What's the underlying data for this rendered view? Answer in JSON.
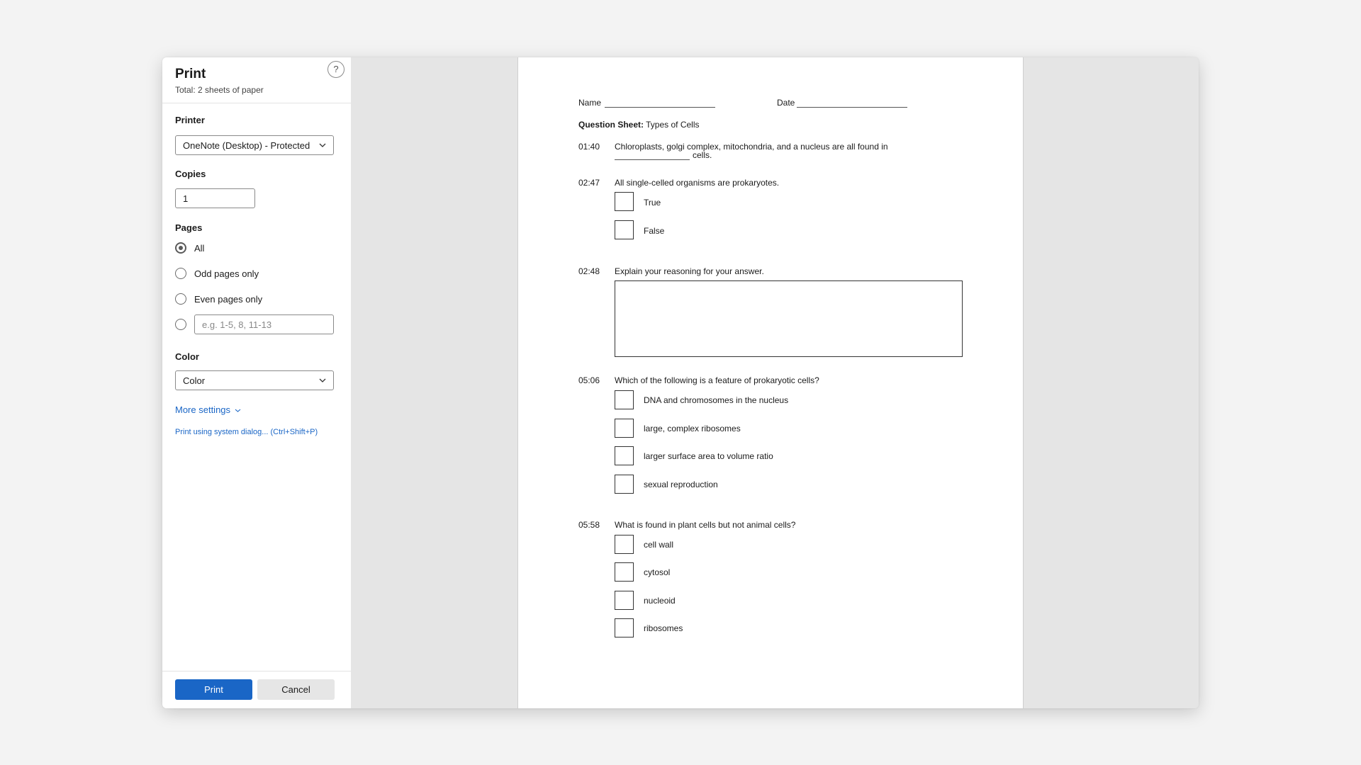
{
  "panel": {
    "title": "Print",
    "subtitle": "Total: 2 sheets of paper",
    "help_icon": "?",
    "printer_label": "Printer",
    "printer_value": "OneNote (Desktop) - Protected",
    "copies_label": "Copies",
    "copies_value": "1",
    "pages_label": "Pages",
    "pages_options": [
      "All",
      "Odd pages only",
      "Even pages only"
    ],
    "pages_selected": "All",
    "pages_range_placeholder": "e.g. 1-5, 8, 11-13",
    "color_label": "Color",
    "color_value": "Color",
    "more_settings": "More settings",
    "system_dialog": "Print using system dialog... (Ctrl+Shift+P)",
    "print_button": "Print",
    "cancel_button": "Cancel",
    "accent_color": "#1a66c6"
  },
  "document": {
    "name_label": "Name",
    "date_label": "Date",
    "sheet_title_bold": "Question Sheet:",
    "sheet_title_rest": " Types of Cells",
    "questions": [
      {
        "time": "01:40",
        "text": "Chloroplasts, golgi complex, mitochondria, and a nucleus are all found in",
        "text2": "cells."
      },
      {
        "time": "02:47",
        "text": "All single-celled organisms are prokaryotes.",
        "options": [
          "True",
          "False"
        ]
      },
      {
        "time": "02:48",
        "text": "Explain your reasoning for your answer."
      },
      {
        "time": "05:06",
        "text": "Which of the following is a feature of prokaryotic cells?",
        "options": [
          "DNA and chromosomes in the nucleus",
          "large, complex ribosomes",
          "larger surface area to volume ratio",
          "sexual reproduction"
        ]
      },
      {
        "time": "05:58",
        "text": "What is found in plant cells but not animal cells?",
        "options": [
          "cell wall",
          "cytosol",
          "nucleoid",
          "ribosomes"
        ]
      }
    ]
  }
}
